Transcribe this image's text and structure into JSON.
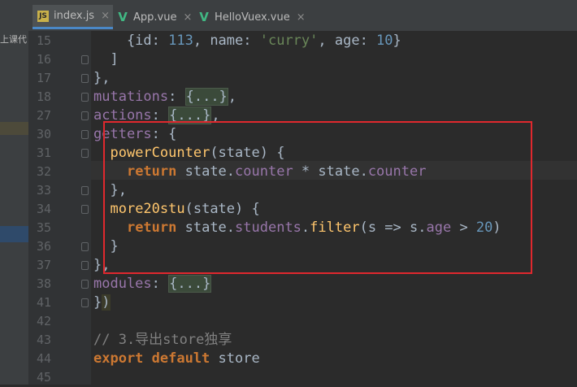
{
  "left_panel": {
    "note": "上课代"
  },
  "tabs": [
    {
      "label": "index.js",
      "icon": "js-file-icon",
      "active": true
    },
    {
      "label": "App.vue",
      "icon": "vue-file-icon",
      "active": false
    },
    {
      "label": "HelloVuex.vue",
      "icon": "vue-file-icon",
      "active": false
    }
  ],
  "tab_close": "×",
  "lines": [
    {
      "num": "15",
      "code": "    {id: 113, name: 'curry', age: 10}"
    },
    {
      "num": "16",
      "code": "  ]"
    },
    {
      "num": "17",
      "code": "},"
    },
    {
      "num": "18",
      "code": "mutations: {...},"
    },
    {
      "num": "27",
      "code": "actions: {...},"
    },
    {
      "num": "30",
      "code": "getters: {"
    },
    {
      "num": "31",
      "code": "  powerCounter(state) {"
    },
    {
      "num": "32",
      "code": "    return state.counter * state.counter"
    },
    {
      "num": "33",
      "code": "  },"
    },
    {
      "num": "34",
      "code": "  more20stu(state) {"
    },
    {
      "num": "35",
      "code": "    return state.students.filter(s => s.age > 20)"
    },
    {
      "num": "36",
      "code": "  }"
    },
    {
      "num": "37",
      "code": "},"
    },
    {
      "num": "38",
      "code": "modules: {...}"
    },
    {
      "num": "41",
      "code": "})"
    },
    {
      "num": "42",
      "code": ""
    },
    {
      "num": "43",
      "code": "// 3.导出store独享"
    },
    {
      "num": "44",
      "code": "export default store"
    },
    {
      "num": "45",
      "code": ""
    }
  ],
  "colors": {
    "background": "#2b2b2b",
    "keyword": "#cc7832",
    "number": "#6897bb",
    "string": "#6a8759",
    "property": "#9876aa",
    "function": "#ffc66d",
    "highlight_box": "#e0282e"
  }
}
